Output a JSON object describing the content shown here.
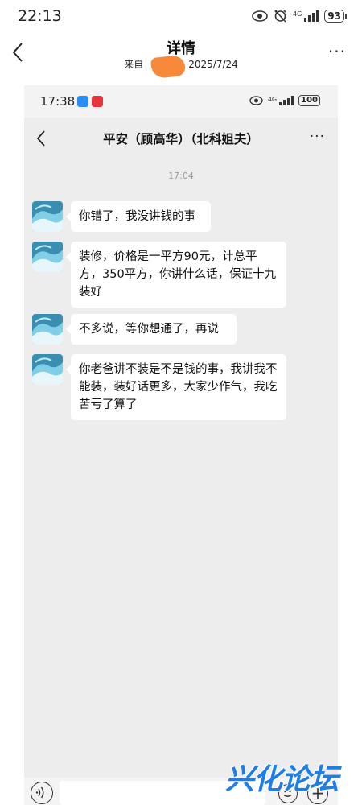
{
  "status_bar": {
    "time": "22:13",
    "network": "4G",
    "battery": "93"
  },
  "header": {
    "title": "详情",
    "source_prefix": "来自",
    "source_date": "2025/7/24",
    "more_label": "···"
  },
  "inner": {
    "status_bar": {
      "time": "17:38",
      "network": "4G",
      "battery": "100"
    },
    "chat_header": {
      "title": "平安（顾高华）（北科姐夫）",
      "more_label": "···"
    },
    "timestamp": "17:04",
    "messages": [
      {
        "text": "你错了，我没讲钱的事"
      },
      {
        "text": "装修，价格是一平方90元，计总平方，350平方，你讲什么话，保证十九装好"
      },
      {
        "text": "不多说，等你想通了，再说"
      },
      {
        "text": "你老爸讲不装是不是钱的事，我讲我不能装，装好话更多，大家少作气，我吃苦亏了算了"
      }
    ]
  },
  "watermark": {
    "text": "兴化论坛",
    "color": "#1f7de6"
  },
  "colors": {
    "chat_bg": "#ededed",
    "bubble": "#ffffff",
    "smear": "#f7893b"
  }
}
